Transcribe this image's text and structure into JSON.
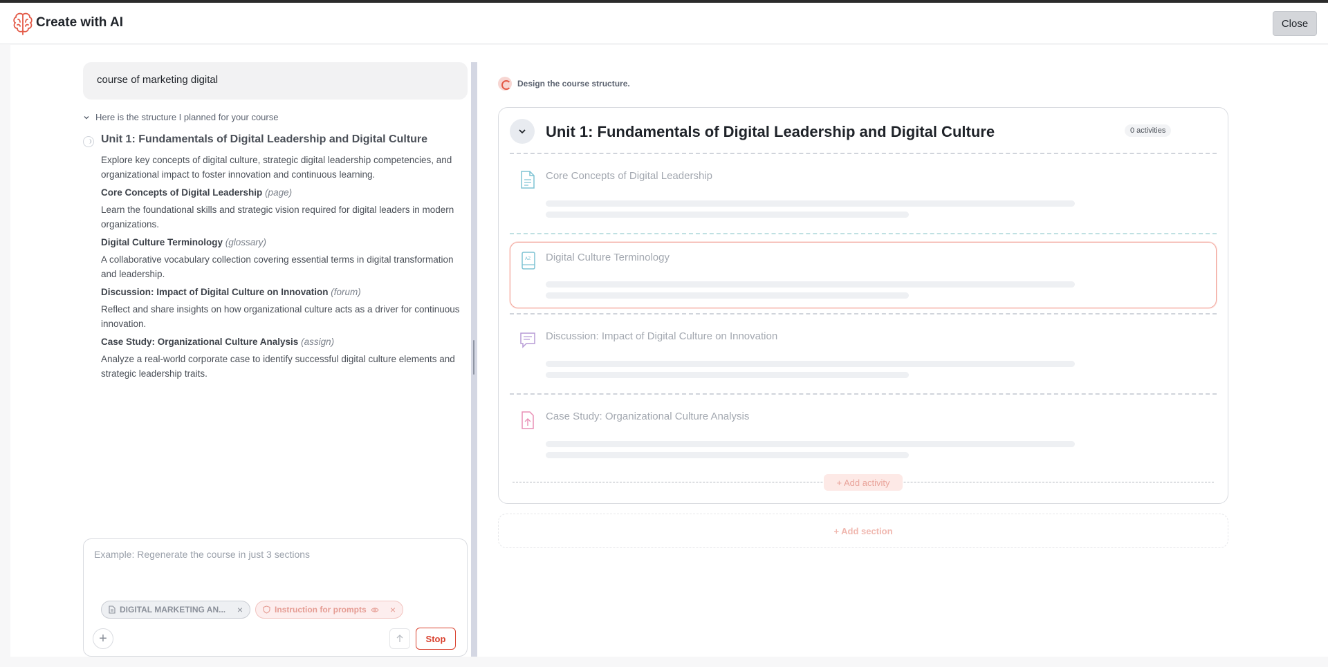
{
  "header": {
    "title": "Create with AI",
    "close_label": "Close",
    "logo_icon": "brain-icon",
    "accent_color": "#e35a47"
  },
  "chat": {
    "user_prompt": "course of marketing digital",
    "plan_intro": "Here is the structure I planned for your course",
    "unit": {
      "title": "Unit 1: Fundamentals of Digital Leadership and Digital Culture",
      "description": "Explore key concepts of digital culture, strategic digital leadership competencies, and organizational impact to foster innovation and continuous learning."
    },
    "activities": [
      {
        "title": "Core Concepts of Digital Leadership",
        "type": "(page)",
        "description": "Learn the foundational skills and strategic vision required for digital leaders in modern organizations."
      },
      {
        "title": "Digital Culture Terminology",
        "type": "(glossary)",
        "description": "A collaborative vocabulary collection covering essential terms in digital transformation and leadership."
      },
      {
        "title": "Discussion: Impact of Digital Culture on Innovation",
        "type": "(forum)",
        "description": "Reflect and share insights on how organizational culture acts as a driver for continuous innovation."
      },
      {
        "title": "Case Study: Organizational Culture Analysis",
        "type": "(assign)",
        "description": "Analyze a real-world corporate case to identify successful digital culture elements and strategic leadership traits."
      }
    ],
    "input": {
      "placeholder": "Example: Regenerate the course in just 3 sections",
      "chips": [
        {
          "label": "DIGITAL MARKETING AN...",
          "icon": "document-icon"
        },
        {
          "label": "Instruction for prompts",
          "icon": "shield-icon"
        }
      ],
      "stop_label": "Stop"
    }
  },
  "preview": {
    "status": "Design the course structure.",
    "unit_title": "Unit 1: Fundamentals of Digital Leadership and Digital Culture",
    "activities_badge": "0 activities",
    "activities": [
      {
        "title": "Core Concepts of Digital Leadership",
        "icon": "page-icon",
        "color": "#7fc3d4"
      },
      {
        "title": "Digital Culture Terminology",
        "icon": "glossary-icon",
        "color": "#7fc3d4"
      },
      {
        "title": "Discussion: Impact of Digital Culture on Innovation",
        "icon": "forum-icon",
        "color": "#b79bd6"
      },
      {
        "title": "Case Study: Organizational Culture Analysis",
        "icon": "assign-icon",
        "color": "#e98fb5"
      }
    ],
    "add_activity_label": "+ Add activity",
    "add_section_label": "+ Add section"
  }
}
